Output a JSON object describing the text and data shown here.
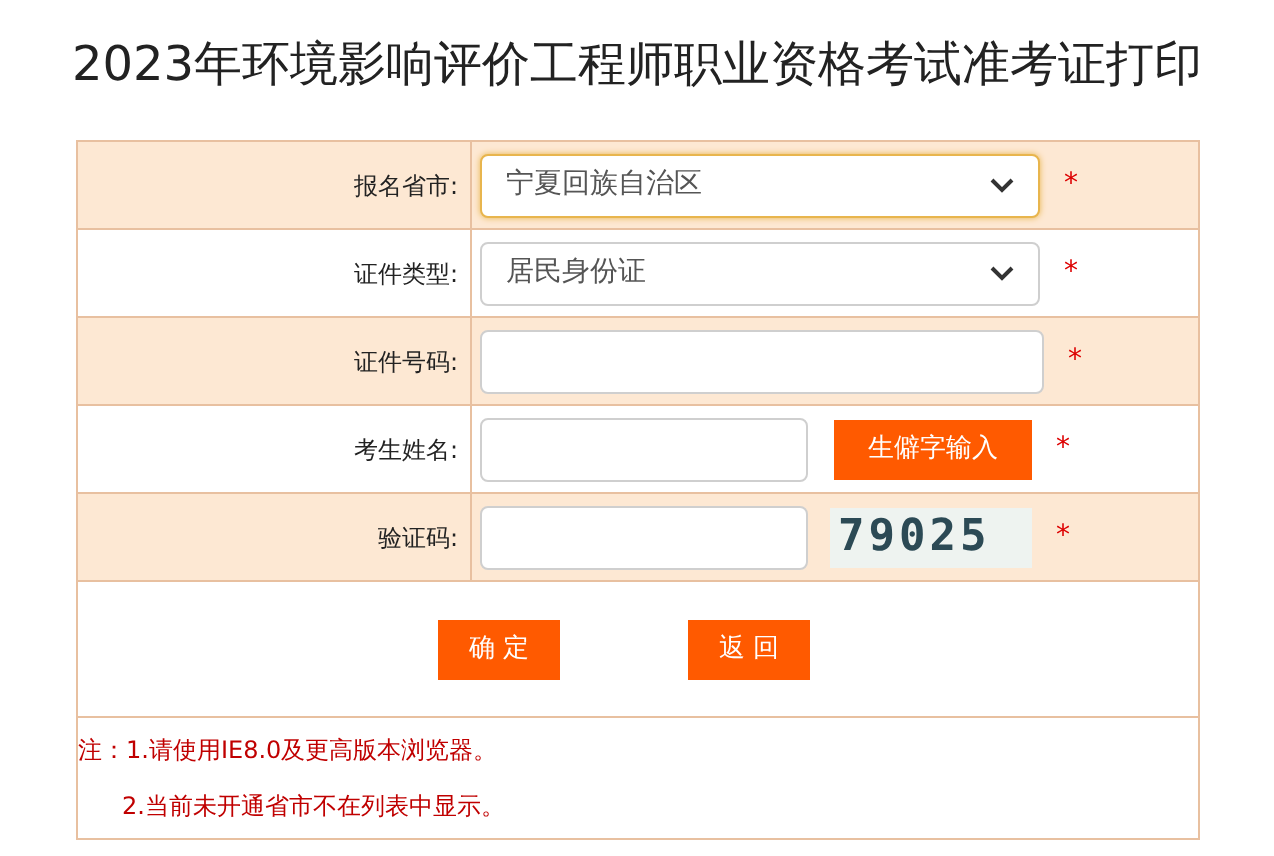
{
  "title": "2023年环境影响评价工程师职业资格考试准考证打印",
  "rows": [
    {
      "kind": "select",
      "label": "报名省市:",
      "value": "宁夏回族自治区",
      "focused": true,
      "required": "*"
    },
    {
      "kind": "select",
      "label": "证件类型:",
      "value": "居民身份证",
      "focused": false,
      "required": "*"
    },
    {
      "kind": "text",
      "label": "证件号码:",
      "required": "*"
    },
    {
      "kind": "text_button",
      "label": "考生姓名:",
      "button": "生僻字输入",
      "required": "*"
    },
    {
      "kind": "captcha",
      "label": "验证码:",
      "captcha": "79025",
      "required": "*"
    }
  ],
  "buttons": [
    "确 定",
    "返 回"
  ],
  "notes": [
    "注：1.请使用IE8.0及更高版本浏览器。",
    "2.当前未开通省市不在列表中显示。"
  ]
}
